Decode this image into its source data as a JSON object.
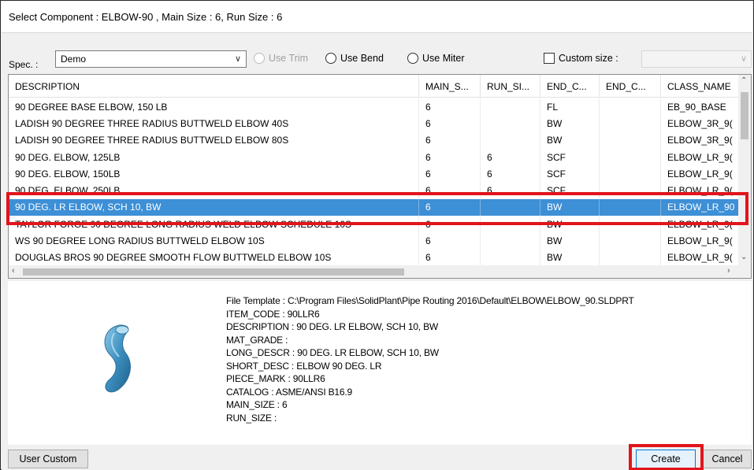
{
  "window": {
    "title": "Select Component : ELBOW-90 , Main Size : 6, Run Size : 6"
  },
  "toolbar": {
    "spec_label": "Spec. :",
    "spec_value": "Demo",
    "use_trim": "Use Trim",
    "use_bend": "Use Bend",
    "use_miter": "Use Miter",
    "custom_size": "Custom size :"
  },
  "table": {
    "columns": [
      "DESCRIPTION",
      "MAIN_S...",
      "RUN_SI...",
      "END_C...",
      "END_C...",
      "CLASS_NAME"
    ],
    "rows": [
      [
        "90 DEGREE BASE ELBOW, 150 LB",
        "6",
        "",
        "FL",
        "",
        "EB_90_BASE"
      ],
      [
        "LADISH 90 DEGREE THREE RADIUS BUTTWELD ELBOW 40S",
        "6",
        "",
        "BW",
        "",
        "ELBOW_3R_9("
      ],
      [
        "LADISH 90 DEGREE THREE RADIUS BUTTWELD ELBOW 80S",
        "6",
        "",
        "BW",
        "",
        "ELBOW_3R_9("
      ],
      [
        "90 DEG. ELBOW, 125LB",
        "6",
        "6",
        "SCF",
        "",
        "ELBOW_LR_9("
      ],
      [
        "90 DEG. ELBOW, 150LB",
        "6",
        "6",
        "SCF",
        "",
        "ELBOW_LR_9("
      ],
      [
        "90 DEG. ELBOW, 250LB",
        "6",
        "6",
        "SCF",
        "",
        "ELBOW_LR_9("
      ],
      [
        "90 DEG. LR ELBOW, SCH 10, BW",
        "6",
        "",
        "BW",
        "",
        "ELBOW_LR_90"
      ],
      [
        "TAYLOR FORGE 90 DEGREE LONG RADIUS WELD ELBOW SCHEDULE 10S",
        "6",
        "",
        "BW",
        "",
        "ELBOW_LR_9("
      ],
      [
        "WS 90 DEGREE LONG RADIUS BUTTWELD ELBOW 10S",
        "6",
        "",
        "BW",
        "",
        "ELBOW_LR_9("
      ],
      [
        "DOUGLAS BROS 90 DEGREE SMOOTH FLOW BUTTWELD ELBOW 10S",
        "6",
        "",
        "BW",
        "",
        "ELBOW_LR_9("
      ]
    ],
    "selected_index": 6
  },
  "details": {
    "lines": [
      "File Template : C:\\Program Files\\SolidPlant\\Pipe Routing 2016\\Default\\ELBOW\\ELBOW_90.SLDPRT",
      "ITEM_CODE : 90LLR6",
      "DESCRIPTION : 90 DEG. LR ELBOW, SCH 10, BW",
      "MAT_GRADE :",
      "LONG_DESCR : 90 DEG. LR ELBOW, SCH 10, BW",
      "SHORT_DESC : ELBOW 90 DEG. LR",
      "PIECE_MARK : 90LLR6",
      "CATALOG : ASME/ANSI B16.9",
      "MAIN_SIZE : 6",
      "RUN_SIZE :"
    ]
  },
  "buttons": {
    "user_custom": "User Custom",
    "create": "Create",
    "cancel": "Cancel"
  },
  "colors": {
    "selection": "#3d8fd6",
    "highlight_annotation": "#e1141c"
  }
}
